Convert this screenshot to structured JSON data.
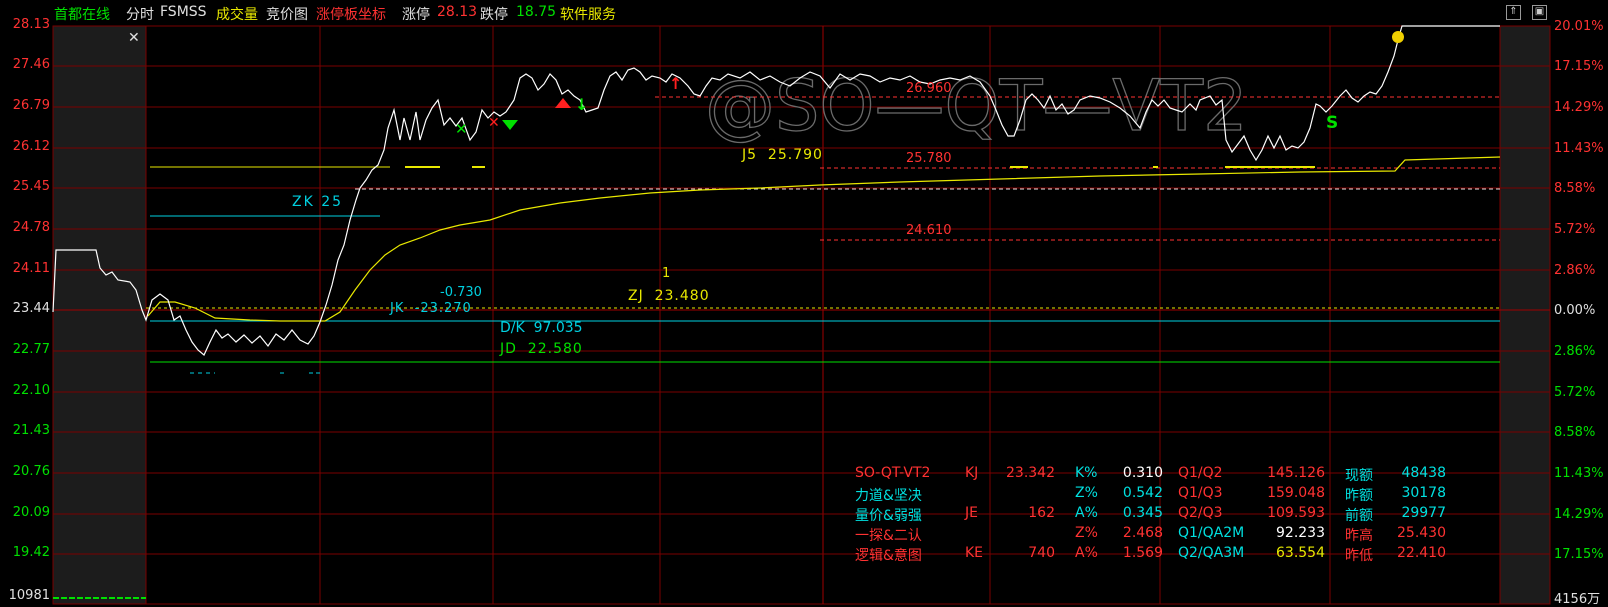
{
  "header": {
    "stock_name": "首都在线",
    "mode": "分时",
    "indicator": "FSMSS",
    "volume": "成交量",
    "auction": "竞价图",
    "limit_coord": "涨停板坐标",
    "limit_up_label": "涨停",
    "limit_up_value": "28.13",
    "limit_down_label": "跌停",
    "limit_down_value": "18.75",
    "sector": "软件服务"
  },
  "left_axis": [
    "28.13",
    "27.46",
    "26.79",
    "26.12",
    "25.45",
    "24.78",
    "24.11",
    "23.44",
    "22.77",
    "22.10",
    "21.43",
    "20.76",
    "20.09",
    "19.42",
    "10981"
  ],
  "right_axis": [
    "20.01%",
    "17.15%",
    "14.29%",
    "11.43%",
    "8.58%",
    "5.72%",
    "2.86%",
    "0.00%",
    "2.86%",
    "5.72%",
    "8.58%",
    "11.43%",
    "14.29%",
    "17.15%",
    "4156万"
  ],
  "watermark": "@SO—QT—VT2",
  "annotations": {
    "zk": "ZK 25",
    "j5": "J5  25.790",
    "level1": "25.780",
    "level2": "26.960",
    "level3": "24.610",
    "one": "1",
    "zj": "ZJ  23.480",
    "jk_val": "-0.730",
    "jk": "JK  -23.270",
    "dk": "D/K  97.035",
    "jd": "JD  22.580",
    "signal_s": "S"
  },
  "colors": {
    "grid": "#7a0000",
    "up": "#ff3232",
    "down": "#00e000",
    "price_line": "#ffffff",
    "avg_line": "#e8e800",
    "cyan": "#00d0e0"
  },
  "table": {
    "rows": [
      [
        {
          "t": "SO-QT-VT2",
          "c": "#ff3232"
        },
        {
          "t": "KJ",
          "c": "#ff3232"
        },
        {
          "t": "23.342",
          "c": "#ff3232"
        },
        {
          "t": "K%",
          "c": "#00e0e0"
        },
        {
          "t": "0.310",
          "c": "#ffffff"
        },
        {
          "t": "Q1/Q2",
          "c": "#ff3232"
        },
        {
          "t": "145.126",
          "c": "#ff3232"
        },
        {
          "t": "现额",
          "c": "#00e0e0"
        },
        {
          "t": "48438",
          "c": "#00e0e0"
        }
      ],
      [
        {
          "t": "力道&坚决",
          "c": "#00e0e0"
        },
        {
          "t": "",
          "c": "#ff3232"
        },
        {
          "t": "",
          "c": "#ff3232"
        },
        {
          "t": "Z%",
          "c": "#00e0e0"
        },
        {
          "t": "0.542",
          "c": "#00e0e0"
        },
        {
          "t": "Q1/Q3",
          "c": "#ff3232"
        },
        {
          "t": "159.048",
          "c": "#ff3232"
        },
        {
          "t": "昨额",
          "c": "#00e0e0"
        },
        {
          "t": "30178",
          "c": "#00e0e0"
        }
      ],
      [
        {
          "t": "量价&弱强",
          "c": "#00e0e0"
        },
        {
          "t": "JE",
          "c": "#ff3232"
        },
        {
          "t": "162",
          "c": "#ff3232"
        },
        {
          "t": "A%",
          "c": "#00e0e0"
        },
        {
          "t": "0.345",
          "c": "#00e0e0"
        },
        {
          "t": "Q2/Q3",
          "c": "#ff3232"
        },
        {
          "t": "109.593",
          "c": "#ff3232"
        },
        {
          "t": "前额",
          "c": "#00e0e0"
        },
        {
          "t": "29977",
          "c": "#00e0e0"
        }
      ],
      [
        {
          "t": "一探&二认",
          "c": "#ff3232"
        },
        {
          "t": "",
          "c": "#ff3232"
        },
        {
          "t": "",
          "c": "#ff3232"
        },
        {
          "t": "Z%",
          "c": "#ff3232"
        },
        {
          "t": "2.468",
          "c": "#ff3232"
        },
        {
          "t": "Q1/QA2M",
          "c": "#00e0e0"
        },
        {
          "t": "92.233",
          "c": "#ffffff"
        },
        {
          "t": "昨高",
          "c": "#ff3232"
        },
        {
          "t": "25.430",
          "c": "#ff3232"
        }
      ],
      [
        {
          "t": "逻辑&意图",
          "c": "#ff3232"
        },
        {
          "t": "KE",
          "c": "#ff3232"
        },
        {
          "t": "740",
          "c": "#ff3232"
        },
        {
          "t": "A%",
          "c": "#ff3232"
        },
        {
          "t": "1.569",
          "c": "#ff3232"
        },
        {
          "t": "Q2/QA3M",
          "c": "#00e0e0"
        },
        {
          "t": "63.554",
          "c": "#e8e800"
        },
        {
          "t": "昨低",
          "c": "#ff3232"
        },
        {
          "t": "22.410",
          "c": "#ff3232"
        }
      ]
    ]
  }
}
